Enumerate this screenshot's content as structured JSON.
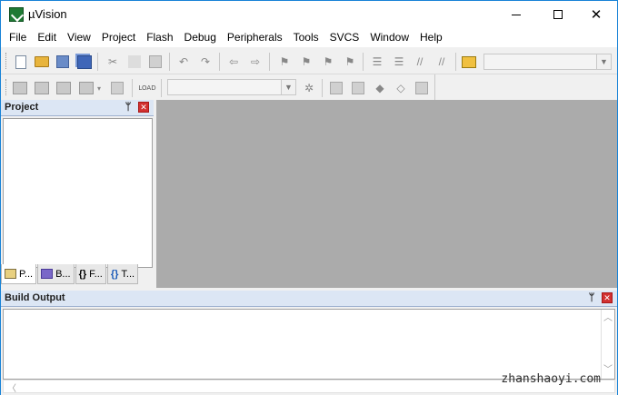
{
  "window": {
    "title": "µVision",
    "controls": {
      "minimize": "—",
      "maximize": "□",
      "close": "✕"
    }
  },
  "menu": [
    "File",
    "Edit",
    "View",
    "Project",
    "Flash",
    "Debug",
    "Peripherals",
    "Tools",
    "SVCS",
    "Window",
    "Help"
  ],
  "toolbar1": {
    "icons": [
      "new-file-icon",
      "open-file-icon",
      "save-icon",
      "save-all-icon",
      "cut-icon",
      "copy-icon",
      "paste-icon",
      "undo-icon",
      "redo-icon",
      "nav-back-icon",
      "nav-forward-icon",
      "bookmark-insert-icon",
      "bookmark-prev-icon",
      "bookmark-next-icon",
      "bookmark-clear-icon",
      "indent-icon",
      "unindent-icon",
      "comment-icon",
      "uncomment-icon",
      "find-in-files-icon"
    ],
    "find_combo": {
      "value": ""
    }
  },
  "toolbar2": {
    "icons": [
      "translate-icon",
      "build-icon",
      "rebuild-icon",
      "batch-build-icon",
      "stop-build-icon",
      "download-icon"
    ],
    "load_label": "LOAD",
    "target_combo": {
      "value": ""
    },
    "more_icons": [
      "target-options-icon",
      "file-extensions-icon",
      "manage-run-time-icon",
      "pack-installer-icon",
      "select-packs-icon"
    ]
  },
  "project_panel": {
    "title": "Project",
    "tabs": [
      {
        "label": "P...",
        "icon": "project-tab-icon"
      },
      {
        "label": "B...",
        "icon": "books-tab-icon"
      },
      {
        "label": "F...",
        "icon": "functions-tab-icon",
        "glyph": "{}"
      },
      {
        "label": "T...",
        "icon": "templates-tab-icon",
        "glyph": "{}"
      }
    ]
  },
  "build_output": {
    "title": "Build Output",
    "content": ""
  },
  "watermark": "zhanshaoyi.com",
  "colors": {
    "panel_header": "#dce6f4",
    "editor_bg": "#ababab",
    "close_red": "#d23030",
    "window_border": "#1883d7"
  }
}
